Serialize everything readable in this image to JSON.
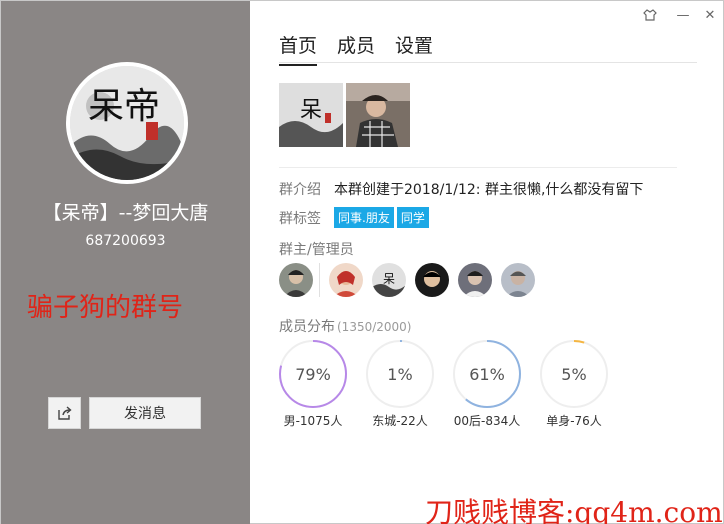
{
  "window_controls": {
    "skin_icon": "shirt-icon",
    "minimize": "—",
    "close": "✕"
  },
  "profile": {
    "group_name": "【呆帝】--梦回大唐",
    "group_id": "687200693",
    "avatar_text": "呆帝",
    "send_button": "发消息",
    "share_icon": "share-icon"
  },
  "overlay_note": "骗子狗的群号",
  "tabs": [
    {
      "label": "首页",
      "active": true
    },
    {
      "label": "成员",
      "active": false
    },
    {
      "label": "设置",
      "active": false
    }
  ],
  "info": {
    "intro_label": "群介绍",
    "intro_text": "本群创建于2018/1/12: 群主很懒,什么都没有留下",
    "tags_label": "群标签",
    "tags": [
      "同事.朋友",
      "同学"
    ],
    "admins_label": "群主/管理员"
  },
  "distribution": {
    "title": "成员分布",
    "count": "(1350/2000)",
    "stats": [
      {
        "percent_text": "79%",
        "value": 0.79,
        "color": "#b788e8",
        "label": "男-1075人"
      },
      {
        "percent_text": "1%",
        "value": 0.01,
        "color": "#8fb3e0",
        "label": "东城-22人"
      },
      {
        "percent_text": "61%",
        "value": 0.61,
        "color": "#8fb3e0",
        "label": "00后-834人"
      },
      {
        "percent_text": "5%",
        "value": 0.05,
        "color": "#f5b642",
        "label": "单身-76人"
      }
    ]
  },
  "watermark": "刀贱贱博客:qq4m.com"
}
